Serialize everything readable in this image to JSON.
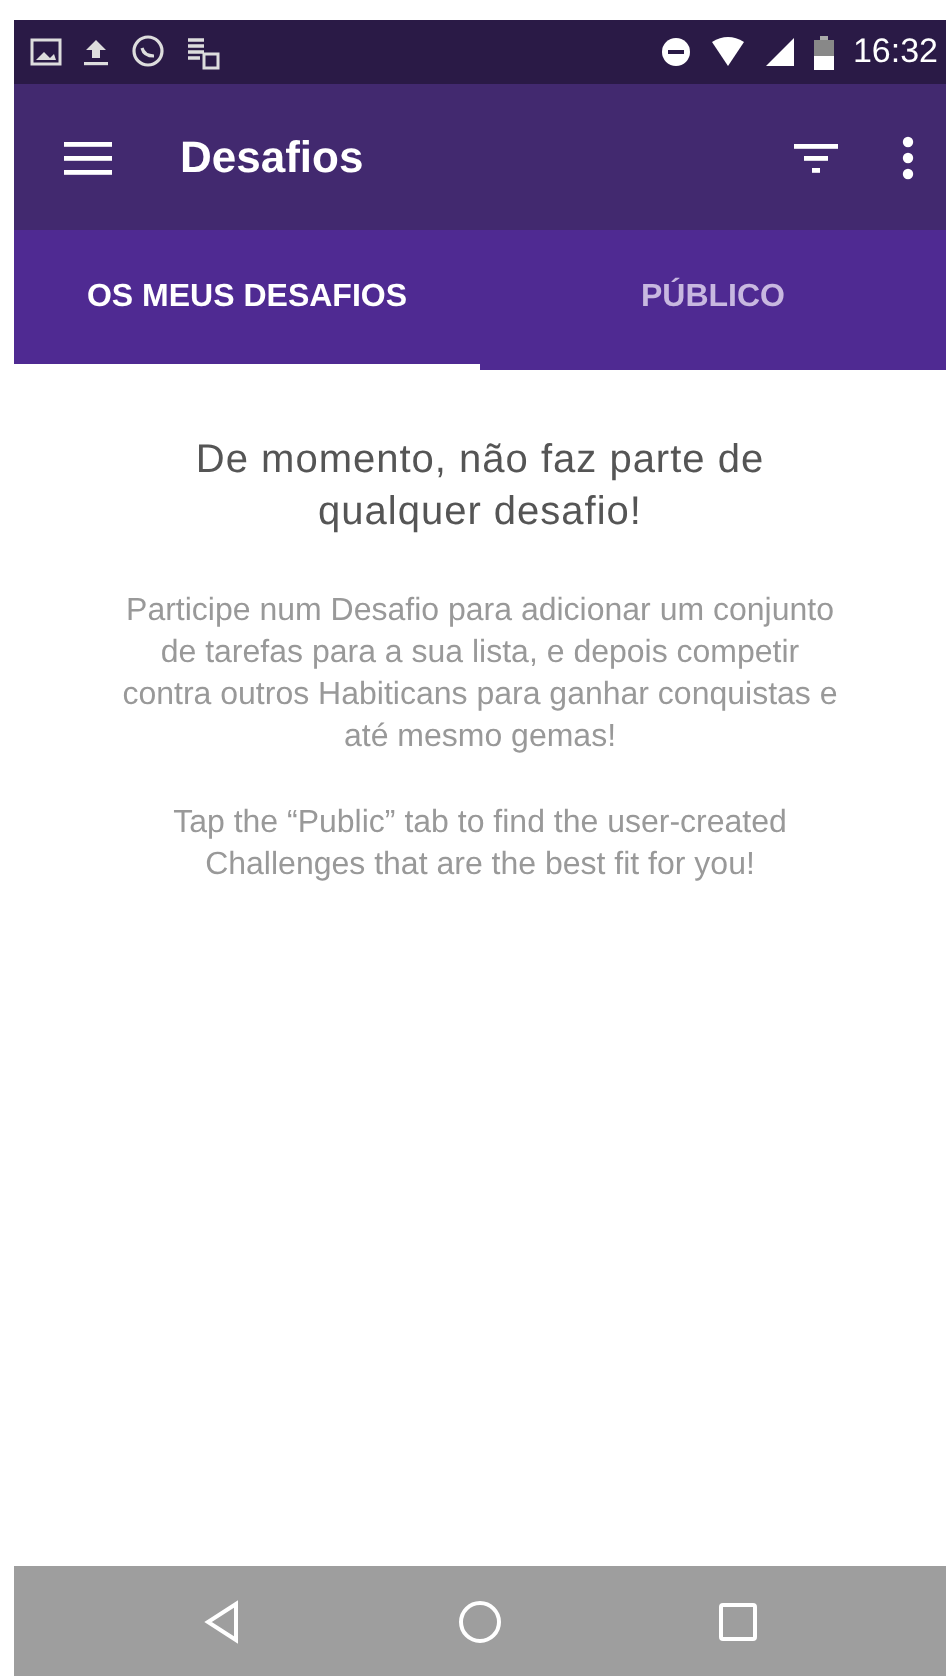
{
  "status_bar": {
    "time": "16:32"
  },
  "app_bar": {
    "title": "Desafios"
  },
  "tabs": [
    {
      "label": "OS MEUS DESAFIOS",
      "selected": true
    },
    {
      "label": "PÚBLICO",
      "selected": false
    }
  ],
  "empty_state": {
    "title": "De momento, não faz parte de qualquer desafio!",
    "description": "Participe num Desafio para adicionar um conjunto de tarefas para a sua lista, e depois competir contra outros Habiticans para ganhar conquistas e até mesmo gemas!",
    "hint": "Tap the “Public” tab to find the user-created Challenges that are the best fit for you!"
  }
}
